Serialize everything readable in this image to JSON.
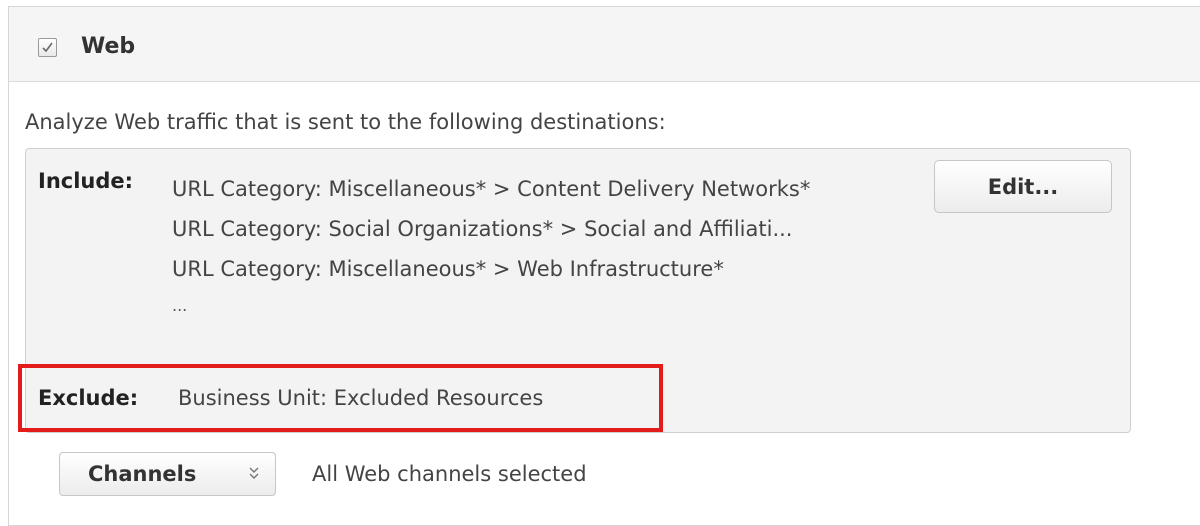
{
  "section": {
    "title": "Web",
    "checked": true
  },
  "description": "Analyze Web traffic that is sent to the following destinations:",
  "destinations": {
    "include_label": "Include:",
    "include_items": [
      "URL Category: Miscellaneous* > Content Delivery Networks*",
      "URL Category: Social Organizations* > Social and Affiliati...",
      "URL Category: Miscellaneous* > Web Infrastructure*"
    ],
    "include_more": "...",
    "exclude_label": "Exclude:",
    "exclude_value": "Business Unit: Excluded Resources",
    "edit_label": "Edit..."
  },
  "channels": {
    "button_label": "Channels",
    "status": "All Web channels selected"
  },
  "colors": {
    "highlight": "#e31b1b",
    "header_bg": "#f5f5f5",
    "box_bg": "#f3f3f3"
  },
  "icons": {
    "checkbox": "checkmark-icon",
    "channels": "double-chevron-down-icon"
  }
}
